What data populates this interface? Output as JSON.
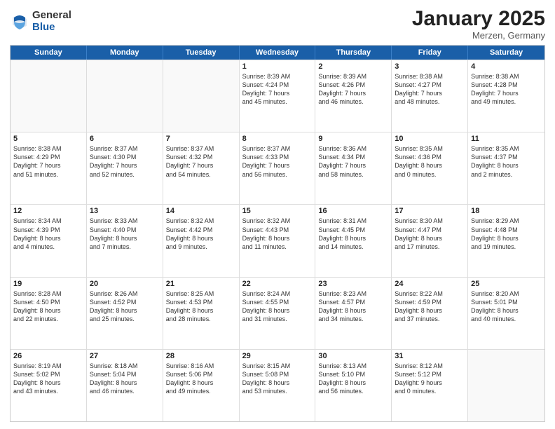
{
  "logo": {
    "general": "General",
    "blue": "Blue"
  },
  "header": {
    "month": "January 2025",
    "location": "Merzen, Germany"
  },
  "weekdays": [
    "Sunday",
    "Monday",
    "Tuesday",
    "Wednesday",
    "Thursday",
    "Friday",
    "Saturday"
  ],
  "rows": [
    [
      {
        "day": "",
        "info": ""
      },
      {
        "day": "",
        "info": ""
      },
      {
        "day": "",
        "info": ""
      },
      {
        "day": "1",
        "info": "Sunrise: 8:39 AM\nSunset: 4:24 PM\nDaylight: 7 hours\nand 45 minutes."
      },
      {
        "day": "2",
        "info": "Sunrise: 8:39 AM\nSunset: 4:26 PM\nDaylight: 7 hours\nand 46 minutes."
      },
      {
        "day": "3",
        "info": "Sunrise: 8:38 AM\nSunset: 4:27 PM\nDaylight: 7 hours\nand 48 minutes."
      },
      {
        "day": "4",
        "info": "Sunrise: 8:38 AM\nSunset: 4:28 PM\nDaylight: 7 hours\nand 49 minutes."
      }
    ],
    [
      {
        "day": "5",
        "info": "Sunrise: 8:38 AM\nSunset: 4:29 PM\nDaylight: 7 hours\nand 51 minutes."
      },
      {
        "day": "6",
        "info": "Sunrise: 8:37 AM\nSunset: 4:30 PM\nDaylight: 7 hours\nand 52 minutes."
      },
      {
        "day": "7",
        "info": "Sunrise: 8:37 AM\nSunset: 4:32 PM\nDaylight: 7 hours\nand 54 minutes."
      },
      {
        "day": "8",
        "info": "Sunrise: 8:37 AM\nSunset: 4:33 PM\nDaylight: 7 hours\nand 56 minutes."
      },
      {
        "day": "9",
        "info": "Sunrise: 8:36 AM\nSunset: 4:34 PM\nDaylight: 7 hours\nand 58 minutes."
      },
      {
        "day": "10",
        "info": "Sunrise: 8:35 AM\nSunset: 4:36 PM\nDaylight: 8 hours\nand 0 minutes."
      },
      {
        "day": "11",
        "info": "Sunrise: 8:35 AM\nSunset: 4:37 PM\nDaylight: 8 hours\nand 2 minutes."
      }
    ],
    [
      {
        "day": "12",
        "info": "Sunrise: 8:34 AM\nSunset: 4:39 PM\nDaylight: 8 hours\nand 4 minutes."
      },
      {
        "day": "13",
        "info": "Sunrise: 8:33 AM\nSunset: 4:40 PM\nDaylight: 8 hours\nand 7 minutes."
      },
      {
        "day": "14",
        "info": "Sunrise: 8:32 AM\nSunset: 4:42 PM\nDaylight: 8 hours\nand 9 minutes."
      },
      {
        "day": "15",
        "info": "Sunrise: 8:32 AM\nSunset: 4:43 PM\nDaylight: 8 hours\nand 11 minutes."
      },
      {
        "day": "16",
        "info": "Sunrise: 8:31 AM\nSunset: 4:45 PM\nDaylight: 8 hours\nand 14 minutes."
      },
      {
        "day": "17",
        "info": "Sunrise: 8:30 AM\nSunset: 4:47 PM\nDaylight: 8 hours\nand 17 minutes."
      },
      {
        "day": "18",
        "info": "Sunrise: 8:29 AM\nSunset: 4:48 PM\nDaylight: 8 hours\nand 19 minutes."
      }
    ],
    [
      {
        "day": "19",
        "info": "Sunrise: 8:28 AM\nSunset: 4:50 PM\nDaylight: 8 hours\nand 22 minutes."
      },
      {
        "day": "20",
        "info": "Sunrise: 8:26 AM\nSunset: 4:52 PM\nDaylight: 8 hours\nand 25 minutes."
      },
      {
        "day": "21",
        "info": "Sunrise: 8:25 AM\nSunset: 4:53 PM\nDaylight: 8 hours\nand 28 minutes."
      },
      {
        "day": "22",
        "info": "Sunrise: 8:24 AM\nSunset: 4:55 PM\nDaylight: 8 hours\nand 31 minutes."
      },
      {
        "day": "23",
        "info": "Sunrise: 8:23 AM\nSunset: 4:57 PM\nDaylight: 8 hours\nand 34 minutes."
      },
      {
        "day": "24",
        "info": "Sunrise: 8:22 AM\nSunset: 4:59 PM\nDaylight: 8 hours\nand 37 minutes."
      },
      {
        "day": "25",
        "info": "Sunrise: 8:20 AM\nSunset: 5:01 PM\nDaylight: 8 hours\nand 40 minutes."
      }
    ],
    [
      {
        "day": "26",
        "info": "Sunrise: 8:19 AM\nSunset: 5:02 PM\nDaylight: 8 hours\nand 43 minutes."
      },
      {
        "day": "27",
        "info": "Sunrise: 8:18 AM\nSunset: 5:04 PM\nDaylight: 8 hours\nand 46 minutes."
      },
      {
        "day": "28",
        "info": "Sunrise: 8:16 AM\nSunset: 5:06 PM\nDaylight: 8 hours\nand 49 minutes."
      },
      {
        "day": "29",
        "info": "Sunrise: 8:15 AM\nSunset: 5:08 PM\nDaylight: 8 hours\nand 53 minutes."
      },
      {
        "day": "30",
        "info": "Sunrise: 8:13 AM\nSunset: 5:10 PM\nDaylight: 8 hours\nand 56 minutes."
      },
      {
        "day": "31",
        "info": "Sunrise: 8:12 AM\nSunset: 5:12 PM\nDaylight: 9 hours\nand 0 minutes."
      },
      {
        "day": "",
        "info": ""
      }
    ]
  ]
}
